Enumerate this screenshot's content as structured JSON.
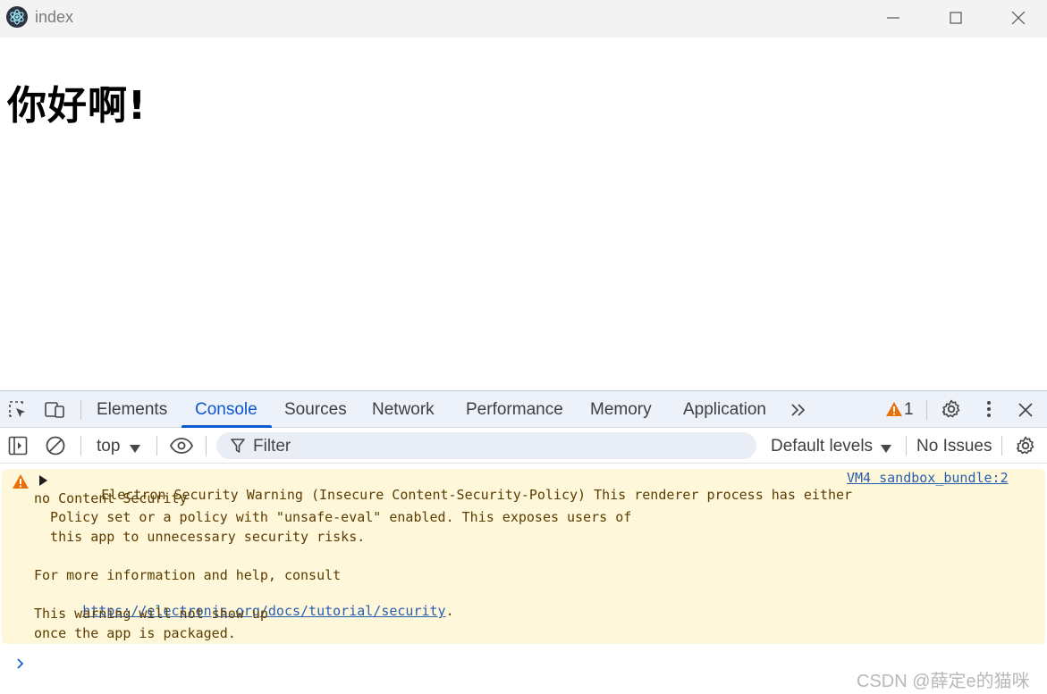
{
  "window": {
    "title": "index",
    "controls": [
      "minimize",
      "maximize",
      "close"
    ]
  },
  "page": {
    "heading": "你好啊!"
  },
  "devtools": {
    "tabs": [
      {
        "label": "Elements",
        "active": false
      },
      {
        "label": "Console",
        "active": true
      },
      {
        "label": "Sources",
        "active": false
      },
      {
        "label": "Network",
        "active": false
      },
      {
        "label": "Performance",
        "active": false
      },
      {
        "label": "Memory",
        "active": false
      },
      {
        "label": "Application",
        "active": false
      }
    ],
    "warning_count": "1",
    "toolbar": {
      "context": "top",
      "filter_placeholder": "Filter",
      "levels": "Default levels",
      "issues": "No Issues"
    },
    "console": {
      "warning": {
        "title": "Electron Security Warning (Insecure Content-Security-Policy)",
        "line1_rest": " This renderer process has either",
        "line2": "no Content Security",
        "line3": "  Policy set or a policy with \"unsafe-eval\" enabled. This exposes users of",
        "line4": "  this app to unnecessary security risks.",
        "line5": "For more information and help, consult",
        "link": "https://electronjs.org/docs/tutorial/security",
        "link_suffix": ".",
        "line7": "This warning will not show up",
        "line8": "once the app is packaged.",
        "source": "VM4 sandbox_bundle:2"
      }
    }
  },
  "watermark": "CSDN @薛定e的猫咪",
  "colors": {
    "accent": "#0b57d0",
    "warning_bg": "#fef7d9",
    "warning_icon": "#e8710a",
    "tabbar_bg": "#edf2fa"
  }
}
